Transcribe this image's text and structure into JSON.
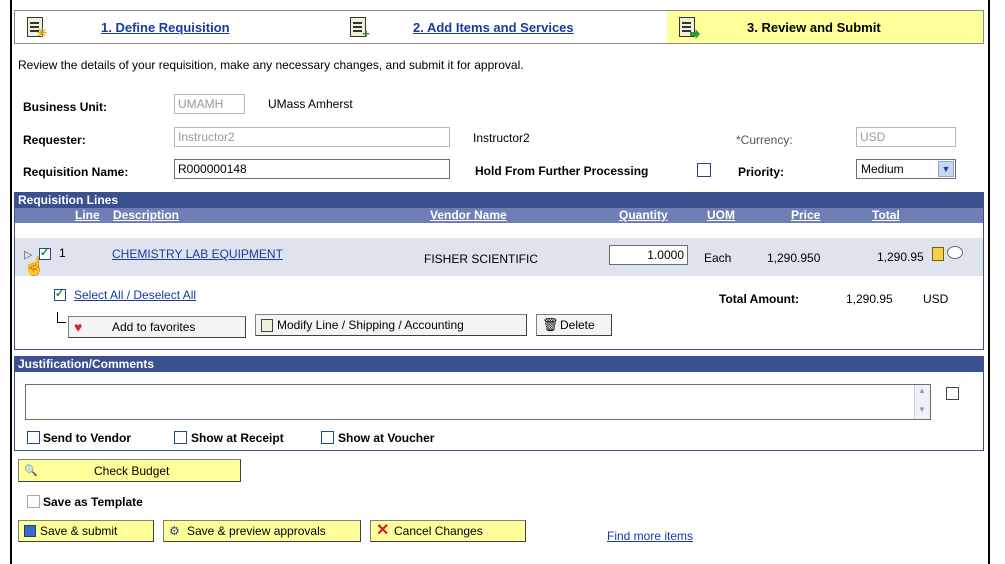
{
  "steps": [
    {
      "label": "1. Define Requisition",
      "icon": "new-document-icon"
    },
    {
      "label": "2. Add Items and Services",
      "icon": "add-document-icon"
    },
    {
      "label": "3. Review and Submit",
      "icon": "submit-document-icon"
    }
  ],
  "instructions": "Review the details of your requisition, make any necessary changes, and submit it for approval.",
  "header": {
    "business_unit_label": "Business Unit:",
    "business_unit_code": "UMAMH",
    "business_unit_name": "UMass Amherst",
    "requester_label": "Requester:",
    "requester_value": "Instructor2",
    "requester_name": "Instructor2",
    "currency_label": "*Currency:",
    "currency_value": "USD",
    "req_name_label": "Requisition Name:",
    "req_name_value": "R000000148",
    "hold_label": "Hold From Further Processing",
    "priority_label": "Priority:",
    "priority_value": "Medium"
  },
  "lines": {
    "title": "Requisition Lines",
    "columns": [
      "Line",
      "Description",
      "Vendor Name",
      "Quantity",
      "UOM",
      "Price",
      "Total"
    ],
    "rows": [
      {
        "line": "1",
        "description": "CHEMISTRY LAB EQUIPMENT",
        "vendor": "FISHER SCIENTIFIC",
        "quantity": "1.0000",
        "uom": "Each",
        "price": "1,290.950",
        "total": "1,290.95"
      }
    ],
    "select_all": "Select All / Deselect All",
    "total_label": "Total Amount:",
    "total_value": "1,290.95",
    "total_currency": "USD",
    "add_favorites": "Add to favorites",
    "modify_line": "Modify Line / Shipping / Accounting",
    "delete": "Delete"
  },
  "comments": {
    "title": "Justification/Comments",
    "text": "",
    "send_to_vendor": "Send to Vendor",
    "show_at_receipt": "Show at Receipt",
    "show_at_voucher": "Show at Voucher"
  },
  "actions": {
    "check_budget": "Check Budget",
    "save_template": "Save as Template",
    "save_submit": "Save & submit",
    "save_preview": "Save & preview approvals",
    "cancel": "Cancel Changes",
    "find_more": "Find more items"
  },
  "colors": {
    "header_bg": "#3c4f8e",
    "row_bg": "#dfe3ee",
    "highlight": "#ffff99",
    "link": "#1a3a9e"
  }
}
